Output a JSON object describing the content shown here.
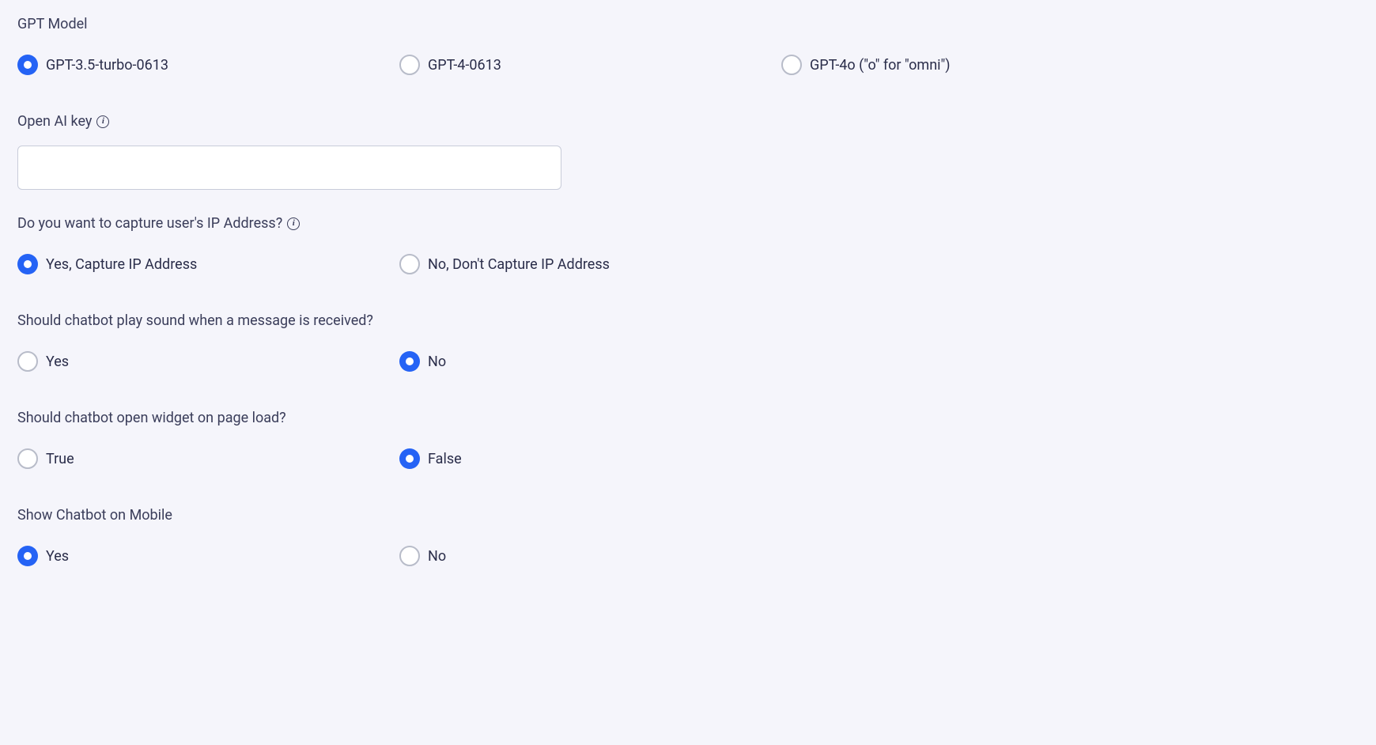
{
  "gpt_model": {
    "label": "GPT Model",
    "options": [
      {
        "label": "GPT-3.5-turbo-0613",
        "selected": true
      },
      {
        "label": "GPT-4-0613",
        "selected": false
      },
      {
        "label": "GPT-4o (\"o\" for \"omni\")",
        "selected": false
      }
    ]
  },
  "openai_key": {
    "label": "Open AI key",
    "value": ""
  },
  "capture_ip": {
    "label": "Do you want to capture user's IP Address?",
    "options": [
      {
        "label": "Yes, Capture IP Address",
        "selected": true
      },
      {
        "label": "No, Don't Capture IP Address",
        "selected": false
      }
    ]
  },
  "play_sound": {
    "label": "Should chatbot play sound when a message is received?",
    "options": [
      {
        "label": "Yes",
        "selected": false
      },
      {
        "label": "No",
        "selected": true
      }
    ]
  },
  "open_widget": {
    "label": "Should chatbot open widget on page load?",
    "options": [
      {
        "label": "True",
        "selected": false
      },
      {
        "label": "False",
        "selected": true
      }
    ]
  },
  "show_mobile": {
    "label": "Show Chatbot on Mobile",
    "options": [
      {
        "label": "Yes",
        "selected": true
      },
      {
        "label": "No",
        "selected": false
      }
    ]
  }
}
